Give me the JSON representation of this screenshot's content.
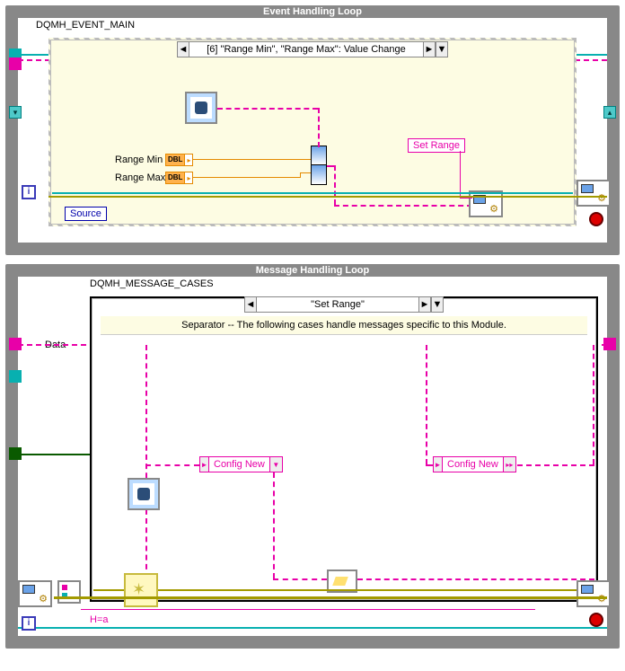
{
  "event_loop": {
    "title": "Event Handling Loop",
    "label": "DQMH_EVENT_MAIN",
    "case_text": "[6] \"Range Min\", \"Range Max\": Value Change",
    "range_min_label": "Range Min",
    "range_max_label": "Range Max",
    "dbl_tag": "DBL",
    "set_range_const": "Set Range",
    "source_label": "Source",
    "iter_label": "i"
  },
  "msg_loop": {
    "title": "Message Handling Loop",
    "label": "DQMH_MESSAGE_CASES",
    "case_text": "\"Set Range\"",
    "comment": "Separator -- The following cases handle messages specific to this Module.",
    "data_label": "Data",
    "config_new_1": "Config New",
    "config_new_2": "Config New",
    "match_label": "H=a",
    "iter_label": "i"
  },
  "arrows": {
    "left": "◄",
    "right": "►",
    "down": "▼",
    "dright": "▸▸"
  }
}
